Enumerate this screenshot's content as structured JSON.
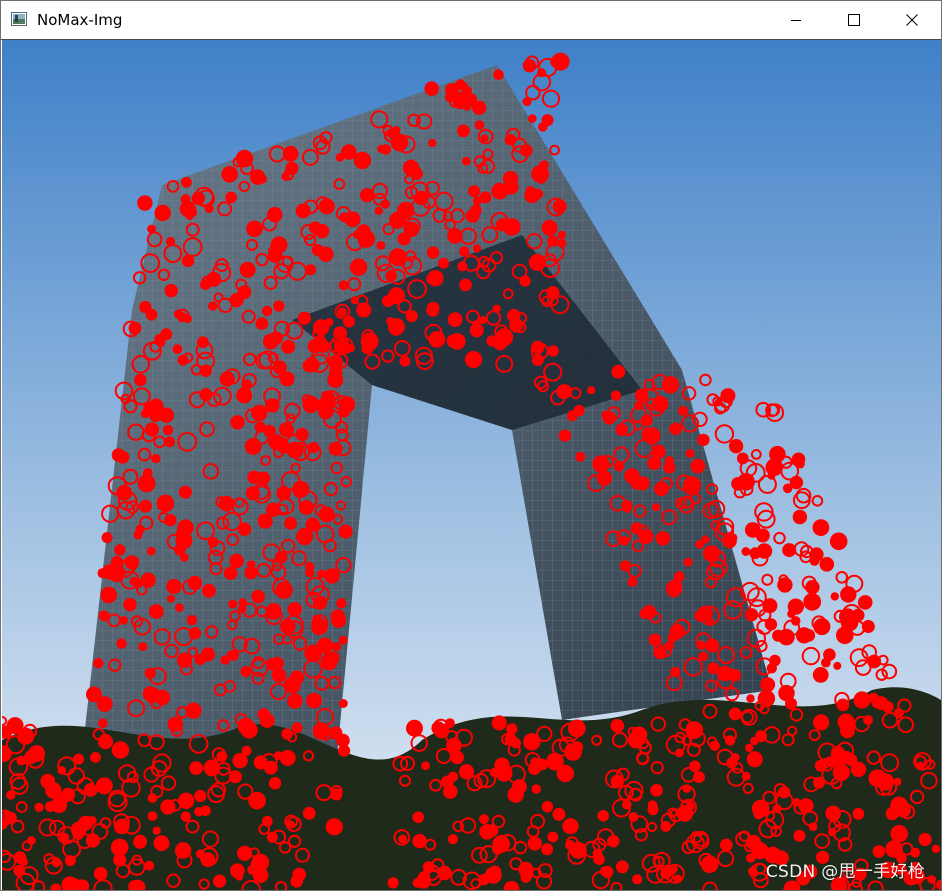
{
  "window": {
    "title": "NoMax-Img",
    "icon": "image-window-icon",
    "controls": {
      "minimize": "minimize-icon",
      "maximize": "maximize-icon",
      "close": "close-icon"
    }
  },
  "image": {
    "content": "photo of a large looped skyscraper against a blue sky, densely overlaid with red circles marking detected points",
    "watermark": "CSDN @甩一手好枪",
    "colors": {
      "sky_top": "#3f80c8",
      "sky_bottom": "#e8eef6",
      "marker": "#ff0000",
      "tower": "#4d5f70",
      "trees": "#1f2a1a"
    }
  }
}
